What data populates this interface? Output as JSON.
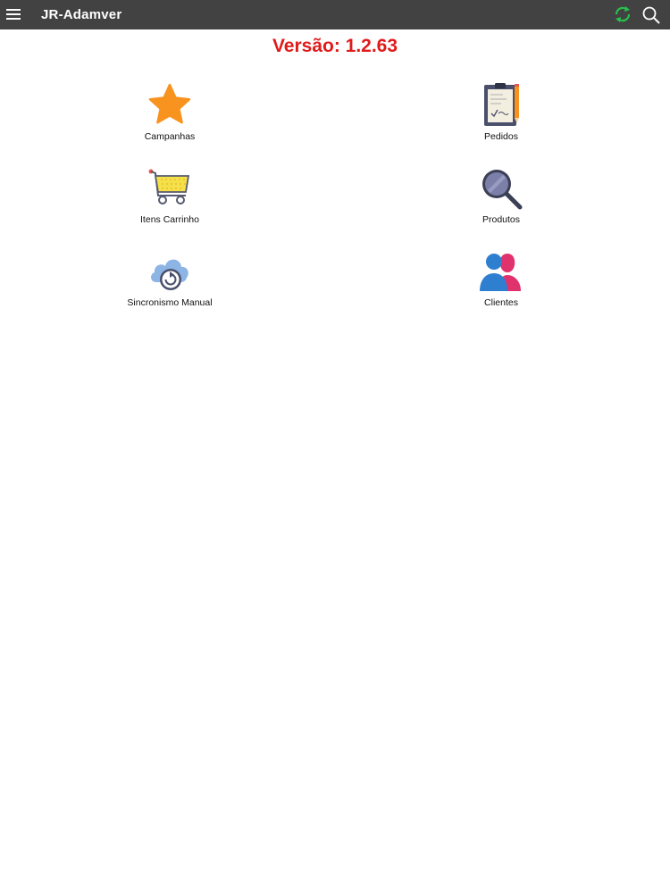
{
  "header": {
    "title": "JR-Adamver",
    "icons": {
      "menu": "hamburger-menu-icon",
      "sync": "sync-icon",
      "search": "search-icon"
    },
    "colors": {
      "bar": "#424242",
      "sync": "#27c24c"
    }
  },
  "version": {
    "text": "Versão: 1.2.63",
    "color": "#e01b1b"
  },
  "tiles": [
    {
      "label": "Campanhas",
      "icon": "star-icon"
    },
    {
      "label": "Pedidos",
      "icon": "clipboard-icon"
    },
    {
      "label": "Itens Carrinho",
      "icon": "shopping-cart-icon"
    },
    {
      "label": "Produtos",
      "icon": "magnifier-icon"
    },
    {
      "label": "Sincronismo Manual",
      "icon": "cloud-sync-icon"
    },
    {
      "label": "Clientes",
      "icon": "users-icon"
    }
  ]
}
